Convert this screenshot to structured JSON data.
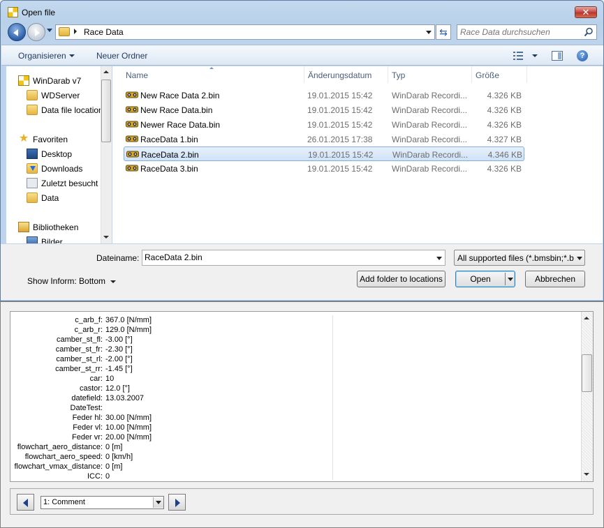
{
  "window": {
    "title": "Open file",
    "close_label": "✕"
  },
  "address": {
    "path": "Race Data",
    "search_placeholder": "Race Data durchsuchen"
  },
  "toolbar": {
    "organise": "Organisieren",
    "new_folder": "Neuer Ordner",
    "help": "?"
  },
  "nav": {
    "items": [
      {
        "label": "WinDarab v7",
        "icon": "windarab-icon"
      },
      {
        "label": "WDServer",
        "icon": "folder-icon"
      },
      {
        "label": "Data file location",
        "icon": "folder-icon"
      },
      {
        "label": "Favoriten",
        "icon": "star-icon"
      },
      {
        "label": "Desktop",
        "icon": "desktop-icon"
      },
      {
        "label": "Downloads",
        "icon": "downloads-icon"
      },
      {
        "label": "Zuletzt besucht",
        "icon": "recent-icon"
      },
      {
        "label": "Data",
        "icon": "folder-icon"
      },
      {
        "label": "Bibliotheken",
        "icon": "library-icon"
      },
      {
        "label": "Bilder",
        "icon": "pictures-icon"
      }
    ]
  },
  "files": {
    "columns": [
      "Name",
      "Änderungsdatum",
      "Typ",
      "Größe"
    ],
    "rows": [
      {
        "name": "New Race Data 2.bin",
        "date": "19.01.2015 15:42",
        "type": "WinDarab Recordi...",
        "size": "4.326 KB"
      },
      {
        "name": "New Race Data.bin",
        "date": "19.01.2015 15:42",
        "type": "WinDarab Recordi...",
        "size": "4.326 KB"
      },
      {
        "name": "Newer Race Data.bin",
        "date": "19.01.2015 15:42",
        "type": "WinDarab Recordi...",
        "size": "4.326 KB"
      },
      {
        "name": "RaceData 1.bin",
        "date": "26.01.2015 17:38",
        "type": "WinDarab Recordi...",
        "size": "4.327 KB"
      },
      {
        "name": "RaceData 2.bin",
        "date": "19.01.2015 15:42",
        "type": "WinDarab Recordi...",
        "size": "4.346 KB",
        "selected": true
      },
      {
        "name": "RaceData 3.bin",
        "date": "19.01.2015 15:42",
        "type": "WinDarab Recordi...",
        "size": "4.326 KB"
      }
    ]
  },
  "footer": {
    "filename_label": "Dateiname:",
    "filename_value": "RaceData 2.bin",
    "filter_value": "All supported files (*.bmsbin;*.b",
    "show_inform": "Show Inform: Bottom",
    "add_folder": "Add folder to locations",
    "open": "Open",
    "cancel": "Abbrechen"
  },
  "info": {
    "properties": [
      {
        "key": "c_arb_f:",
        "value": "367.0 [N/mm]"
      },
      {
        "key": "c_arb_r:",
        "value": "129.0 [N/mm]"
      },
      {
        "key": "camber_st_fl:",
        "value": "-3.00 [°]"
      },
      {
        "key": "camber_st_fr:",
        "value": "-2.30 [°]"
      },
      {
        "key": "camber_st_rl:",
        "value": "-2.00 [°]"
      },
      {
        "key": "camber_st_rr:",
        "value": "-1.45 [°]"
      },
      {
        "key": "car:",
        "value": "10"
      },
      {
        "key": "castor:",
        "value": "12.0 [°]"
      },
      {
        "key": "datefield:",
        "value": "13.03.2007"
      },
      {
        "key": "DateTest:",
        "value": ""
      },
      {
        "key": "Feder hl:",
        "value": "30.00 [N/mm]"
      },
      {
        "key": "Feder vl:",
        "value": "10.00 [N/mm]"
      },
      {
        "key": "Feder vr:",
        "value": "20.00 [N/mm]"
      },
      {
        "key": "flowchart_aero_distance:",
        "value": "0 [m]"
      },
      {
        "key": "flowchart_aero_speed:",
        "value": "0 [km/h]"
      },
      {
        "key": "flowchart_vmax_distance:",
        "value": "0 [m]"
      },
      {
        "key": "ICC:",
        "value": "0"
      }
    ],
    "comment_selected": "1: Comment"
  }
}
